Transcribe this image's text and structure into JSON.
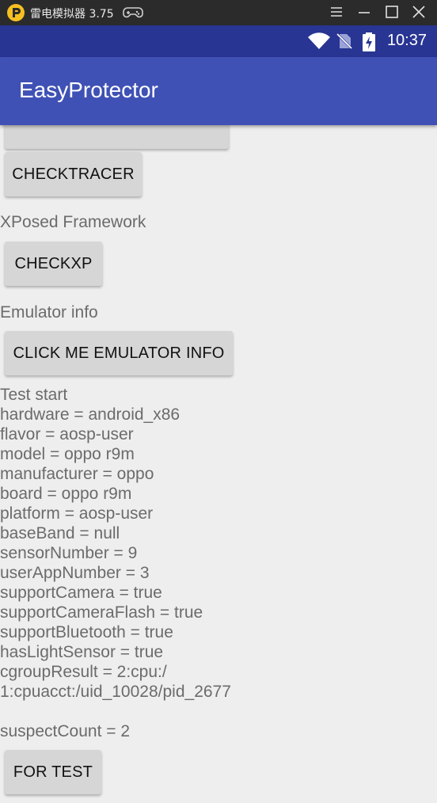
{
  "window": {
    "title": "雷电模拟器 3.75",
    "logo_icon": "leidian-logo-icon",
    "gamepad_icon": "gamepad-icon",
    "controls": [
      "menu-icon",
      "minimize-icon",
      "maximize-icon",
      "close-icon"
    ]
  },
  "status": {
    "time": "10:37",
    "icons": [
      "wifi-icon",
      "no-sim-icon",
      "battery-charging-icon"
    ]
  },
  "app": {
    "title": "EasyProtector",
    "primary_color": "#3f51b5",
    "dark_color": "#283593"
  },
  "content": {
    "checktracer_label": "CHECKTRACER",
    "xposed_heading": "XPosed Framework",
    "checkxp_label": "CHECKXP",
    "emulator_heading": "Emulator info",
    "emulator_button_label": "CLICK ME EMULATOR INFO",
    "info_lines": [
      "Test start",
      "hardware = android_x86",
      "flavor = aosp-user",
      "model = oppo r9m",
      "manufacturer = oppo",
      "board = oppo r9m",
      "platform = aosp-user",
      "baseBand = null",
      "sensorNumber = 9",
      "userAppNumber = 3",
      "supportCamera = true",
      "supportCameraFlash = true",
      "supportBluetooth = true",
      "hasLightSensor = true",
      "cgroupResult = 2:cpu:/",
      "1:cpuacct:/uid_10028/pid_2677",
      "",
      "suspectCount = 2"
    ],
    "for_test_label": "FOR TEST"
  }
}
